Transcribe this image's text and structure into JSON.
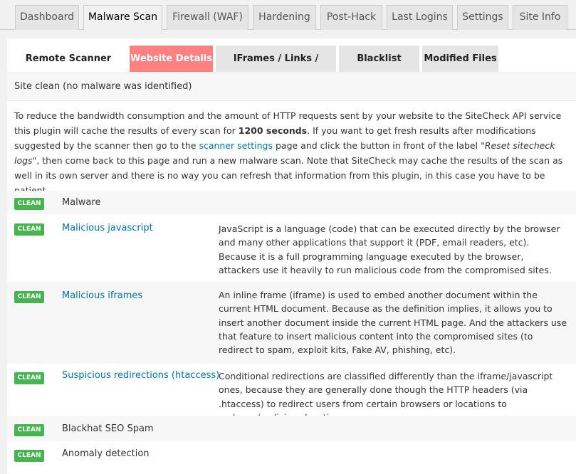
{
  "nav_tabs": [
    "Dashboard",
    "Malware Scan",
    "Firewall (WAF)",
    "Hardening",
    "Post-Hack",
    "Last Logins",
    "Settings",
    "Site Info"
  ],
  "sub_tabs": [
    "Remote Scanner Results",
    "Website Details",
    "IFrames / Links / Scripts",
    "Blacklist Status",
    "Modified Files"
  ],
  "status": "Site clean (no malware was identified)",
  "note": {
    "p1": "To reduce the bandwidth consumption and the amount of HTTP requests sent by your website to the SiteCheck API service this plugin will cache the results of every scan for ",
    "bold": "1200 seconds",
    "p2": ". If you want to get fresh results after modifications suggested by the scanner then go to the ",
    "link": "scanner settings",
    "p3": " page and click the button in front of the label ",
    "italic": "\"Reset sitecheck logs\"",
    "p4": ", then come back to this page and run a new malware scan. Note that SiteCheck may cache the results of the scan as well in its own server and there is no way you can refresh that information from this plugin, in this case you have to be patient."
  },
  "badge_label": "CLEAN",
  "rows": [
    {
      "title": "Malware",
      "desc": ""
    },
    {
      "title": "Malicious javascript",
      "desc": "JavaScript is a language (code) that can be executed directly by the browser and many other applications that support it (PDF, email readers, etc). Because it is a full programming language executed by the browser, attackers use it heavily to run malicious code from the compromised sites."
    },
    {
      "title": "Malicious iframes",
      "desc": "An inline frame (iframe) is used to embed another document within the current HTML document. Because as the definition implies, it allows you to insert another document inside the current HTML page. And the attackers use that feature to insert malicious content into the compromised sites (to redirect to spam, exploit kits, Fake AV, phishing, etc)."
    },
    {
      "title": "Suspicious redirections (htaccess)",
      "desc": "Conditional redirections are classified differently than the iframe/javascript ones, because they are generally done though the HTTP headers (via .htaccess) to redirect users from certain browsers or locations to malware/malicious locations."
    },
    {
      "title": "Blackhat SEO Spam",
      "desc": ""
    },
    {
      "title": "Anomaly detection",
      "desc": ""
    }
  ],
  "colors": {
    "clean_badge": "#46b450",
    "link": "#0073aa",
    "highlight_tab": "#ff8080"
  }
}
